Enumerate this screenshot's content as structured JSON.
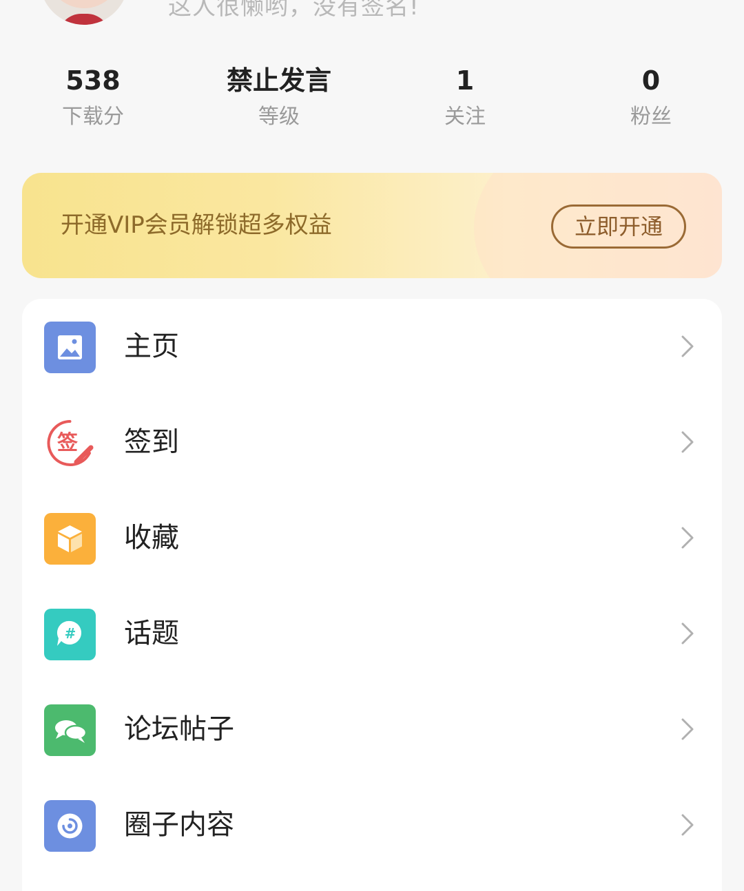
{
  "profile": {
    "signature": "这人很懒哟，没有签名!"
  },
  "stats": [
    {
      "value": "538",
      "label": "下载分"
    },
    {
      "value": "禁止发言",
      "label": "等级"
    },
    {
      "value": "1",
      "label": "关注"
    },
    {
      "value": "0",
      "label": "粉丝"
    }
  ],
  "vip": {
    "text": "开通VIP会员解锁超多权益",
    "button": "立即开通"
  },
  "menu": [
    {
      "label": "主页",
      "icon": "image-icon",
      "color": "#6d8fe0"
    },
    {
      "label": "签到",
      "icon": "sign-in-icon",
      "color": "#e85a5a",
      "glyph": "签"
    },
    {
      "label": "收藏",
      "icon": "box-icon",
      "color": "#fbb03b"
    },
    {
      "label": "话题",
      "icon": "topic-icon",
      "color": "#35cbc0",
      "glyph": "#"
    },
    {
      "label": "论坛帖子",
      "icon": "chat-icon",
      "color": "#4cba6e"
    },
    {
      "label": "圈子内容",
      "icon": "circle-icon",
      "color": "#6d8fe0"
    }
  ]
}
